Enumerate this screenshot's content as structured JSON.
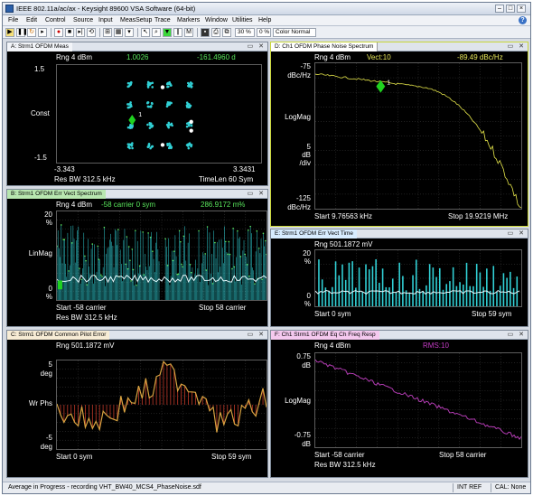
{
  "app": {
    "title": "IEEE 802.11a/ac/ax - Keysight 89600 VSA Software (64-bit)"
  },
  "menu": [
    "File",
    "Edit",
    "Control",
    "Source",
    "Input",
    "MeasSetup",
    "Trace",
    "Markers",
    "Window",
    "Utilities",
    "Help"
  ],
  "toolbar": {
    "pct1": "30 %",
    "pct2": "0 %",
    "color_mode": "Color Normal"
  },
  "windows": {
    "a": {
      "tab": "A: Strm1 OFDM Meas",
      "rng": "Rng 4 dBm",
      "val1": "1.0026",
      "val2": "-161.4960  d",
      "ytop": "1.5",
      "ymid": "Const",
      "ybot": "-1.5",
      "xleft": "-3.343",
      "xright": "3.3431",
      "foot_l": "Res BW 312.5 kHz",
      "foot_r": "TimeLen 60  Sym",
      "marker": "1"
    },
    "d": {
      "tab": "D: Ch1 OFDM Phase Noise Spectrum",
      "rng": "Rng 4 dBm",
      "vect": "Vect:10",
      "val": "-89.49  dBc/Hz",
      "ytop": "-75",
      "ytop_u": "dBc/Hz",
      "ymid": "LogMag",
      "ydiv": "5",
      "ydiv_u1": "dB",
      "ydiv_u2": "/div",
      "ybot": "-125",
      "ybot_u": "dBc/Hz",
      "start": "Start 9.76563 kHz",
      "stop": "Stop 19.9219 MHz",
      "marker": "1"
    },
    "b": {
      "tab": "B: Strm1 OFDM Err Vect Spectrum",
      "rng": "Rng 4 dBm",
      "info": "-58  carrier    0  sym",
      "val": "286.9172  m%",
      "ytop": "20",
      "ytop_u": "%",
      "ymid": "LinMag",
      "ybot": "0",
      "ybot_u": "%",
      "start": "Start -58  carrier",
      "stop": "Stop 58  carrier",
      "foot": "Res BW 312.5 kHz",
      "marker": "1"
    },
    "e": {
      "tab": "E: Strm1 OFDM Err Vect Time",
      "rng": "Rng 501.1872 mV",
      "ytop": "20",
      "ytop_u": "%",
      "ybot": "0",
      "ybot_u": "%",
      "start": "Start 0  sym",
      "stop": "Stop 59  sym"
    },
    "c": {
      "tab": "C: Strm1 OFDM Common Pilot Error",
      "rng": "Rng 501.1872 mV",
      "ytop": "5",
      "ytop_u": "deg",
      "ymid": "Wr Phs",
      "ybot": "-5",
      "ybot_u": "deg",
      "start": "Start 0  sym",
      "stop": "Stop 59  sym"
    },
    "f": {
      "tab": "F: Ch1 Strm1 OFDM Eq Ch Freq Resp",
      "rng": "Rng 4 dBm",
      "rms": "RMS:10",
      "ytop": "0.75",
      "ytop_u": "dB",
      "ymid": "LogMag",
      "ybot": "-0.75",
      "ybot_u": "dB",
      "start": "Start -58  carrier",
      "stop": "Stop 58  carrier",
      "foot": "Res BW 312.5 kHz"
    }
  },
  "status": {
    "msg": "Average in Progress - recording VHT_BW40_MCS4_PhaseNoise.sdf",
    "ref": "INT REF",
    "cal": "CAL: None"
  },
  "colors": {
    "cyan": "#31d1d6",
    "yellow": "#e6e64a",
    "orange": "#d9a441",
    "red": "#c23a2a",
    "magenta": "#b43cb4",
    "green_marker": "#1fd11f"
  }
}
